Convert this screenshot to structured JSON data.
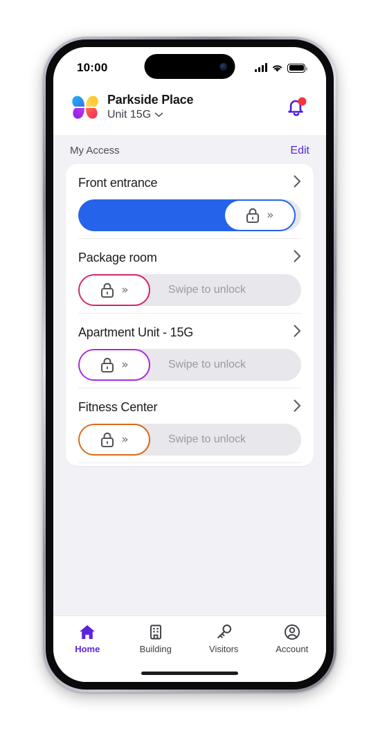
{
  "status_bar": {
    "time": "10:00",
    "cellular_icon": "cellular-bars-icon",
    "wifi_icon": "wifi-icon",
    "battery_icon": "battery-full-icon"
  },
  "header": {
    "logo_icon": "butterfly-logo-icon",
    "building_name": "Parkside Place",
    "unit_label": "Unit 15G",
    "unit_chevron_icon": "chevron-down-icon",
    "bell_icon": "notification-bell-icon",
    "bell_badge": true,
    "bell_color": "#4c1ddb",
    "badge_color": "#f5333f"
  },
  "section": {
    "title": "My Access",
    "edit_label": "Edit",
    "edit_color": "#5a24df"
  },
  "access_items": [
    {
      "name": "Front entrance",
      "chevron_icon": "chevron-right-icon",
      "slider": {
        "hint": "",
        "state": "swiping",
        "progress_percent": 72,
        "accent_color": "#2563eb",
        "fill_color": "#2563eb",
        "lock_icon": "lock-icon",
        "chevrons_glyph": "»"
      }
    },
    {
      "name": "Package room",
      "chevron_icon": "chevron-right-icon",
      "slider": {
        "hint": "Swipe to unlock",
        "state": "locked",
        "progress_percent": 0,
        "accent_color": "#d6246e",
        "fill_color": "",
        "lock_icon": "lock-icon",
        "chevrons_glyph": "»"
      }
    },
    {
      "name": "Apartment Unit - 15G",
      "chevron_icon": "chevron-right-icon",
      "slider": {
        "hint": "Swipe to unlock",
        "state": "locked",
        "progress_percent": 0,
        "accent_color": "#a82ae0",
        "fill_color": "",
        "lock_icon": "lock-icon",
        "chevrons_glyph": "»"
      }
    },
    {
      "name": "Fitness Center",
      "chevron_icon": "chevron-right-icon",
      "slider": {
        "hint": "Swipe to unlock",
        "state": "locked",
        "progress_percent": 0,
        "accent_color": "#d96a18",
        "fill_color": "",
        "lock_icon": "lock-icon",
        "chevrons_glyph": "»"
      }
    }
  ],
  "tab_bar": {
    "active_color": "#5a24df",
    "inactive_color": "#3c3c43",
    "tabs": [
      {
        "label": "Home",
        "icon": "home-icon",
        "active": true
      },
      {
        "label": "Building",
        "icon": "building-icon",
        "active": false
      },
      {
        "label": "Visitors",
        "icon": "key-icon",
        "active": false
      },
      {
        "label": "Account",
        "icon": "account-icon",
        "active": false
      }
    ]
  }
}
